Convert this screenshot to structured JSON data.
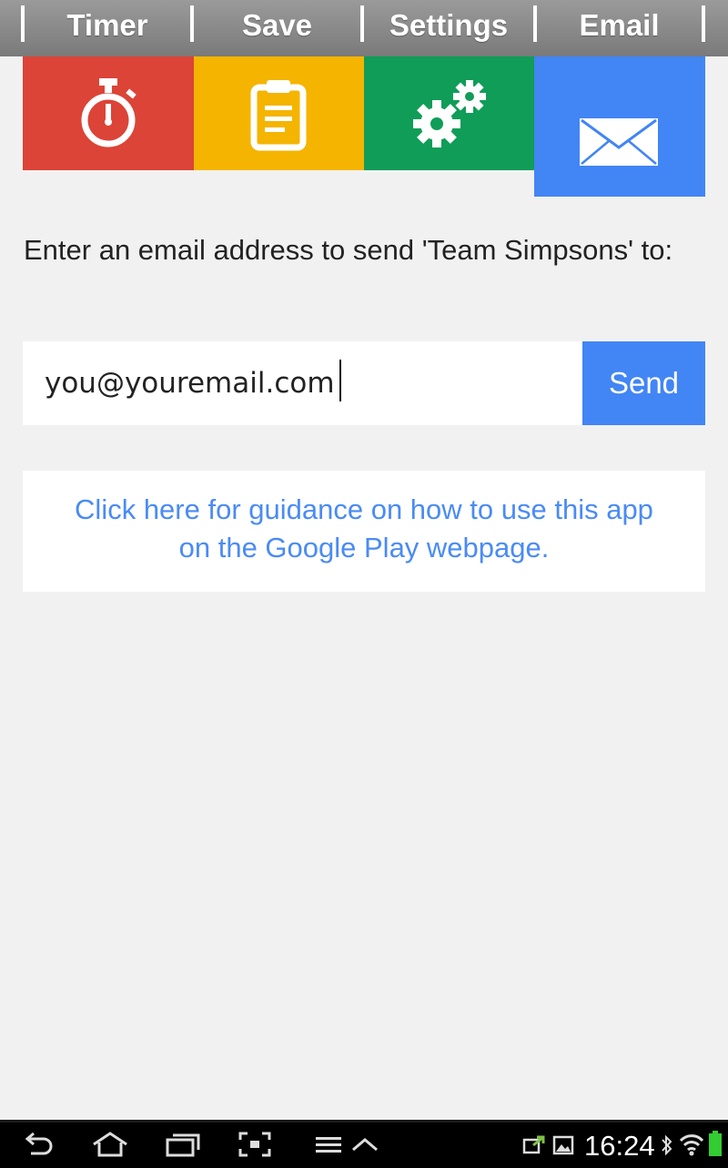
{
  "tabs": [
    {
      "label": "Timer"
    },
    {
      "label": "Save"
    },
    {
      "label": "Settings"
    },
    {
      "label": "Email"
    }
  ],
  "tiles": [
    {
      "icon": "stopwatch-icon",
      "color": "#db4437"
    },
    {
      "icon": "clipboard-icon",
      "color": "#f4b400"
    },
    {
      "icon": "gears-icon",
      "color": "#0f9d58"
    },
    {
      "icon": "envelope-icon",
      "color": "#4285f4"
    }
  ],
  "email_form": {
    "prompt": "Enter an email address to send 'Team Simpsons' to:",
    "input_value": "you@youremail.com",
    "send_label": "Send"
  },
  "guidance": {
    "link_text": "Click here for guidance on how to use this app on the Google Play webpage."
  },
  "status_bar": {
    "time": "16:24",
    "battery_color": "#33cc33"
  }
}
